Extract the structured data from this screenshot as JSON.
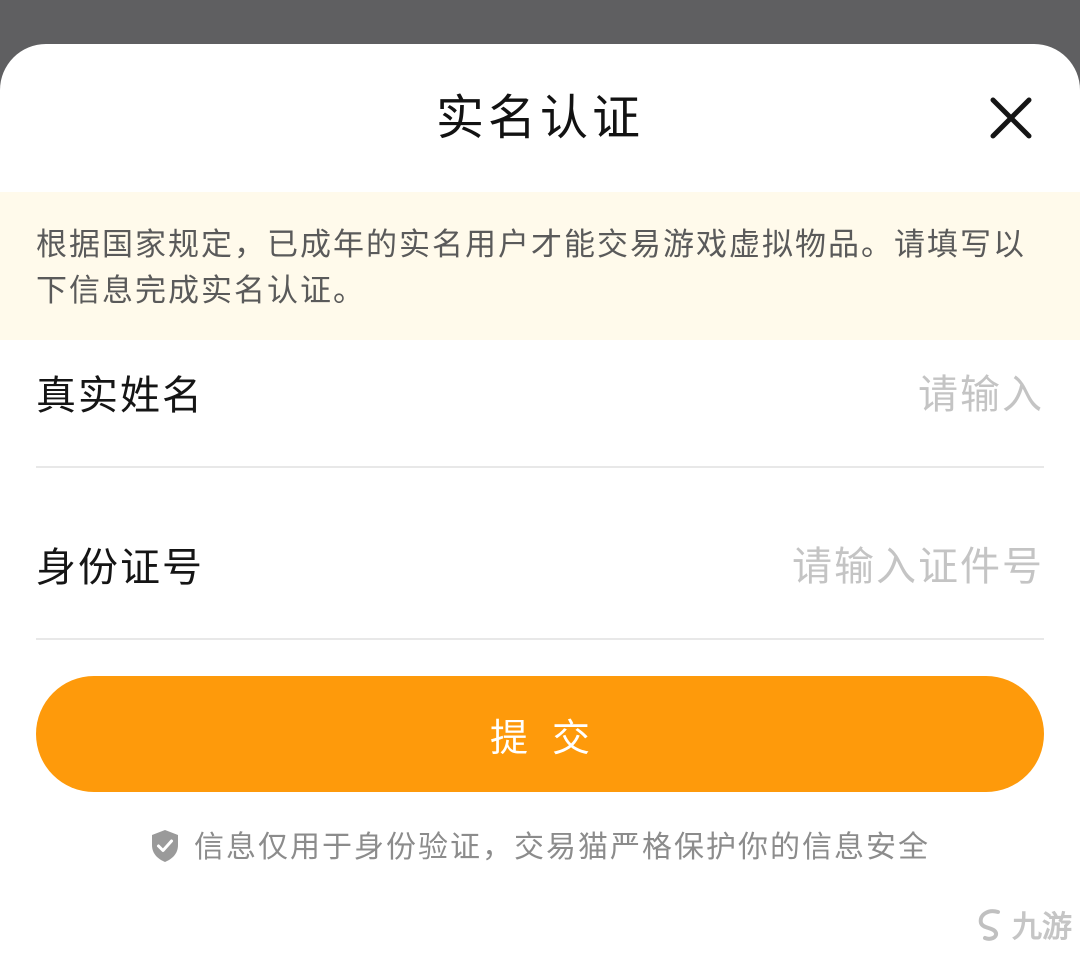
{
  "dialog": {
    "title": "实名认证",
    "notice": "根据国家规定，已成年的实名用户才能交易游戏虚拟物品。请填写以下信息完成实名认证。"
  },
  "form": {
    "name_label": "真实姓名",
    "name_placeholder": "请输入",
    "id_label": "身份证号",
    "id_placeholder": "请输入证件号",
    "submit_label": "提交"
  },
  "footer": {
    "privacy_note": "信息仅用于身份验证，交易猫严格保护你的信息安全"
  },
  "watermark": {
    "text": "九游"
  },
  "colors": {
    "accent": "#fe9a0b",
    "notice_bg": "#fffaeb",
    "overlay": "#5f5f61"
  },
  "icons": {
    "close": "close-icon",
    "shield": "shield-check-icon",
    "watermark_logo": "jiuyou-logo-icon"
  }
}
